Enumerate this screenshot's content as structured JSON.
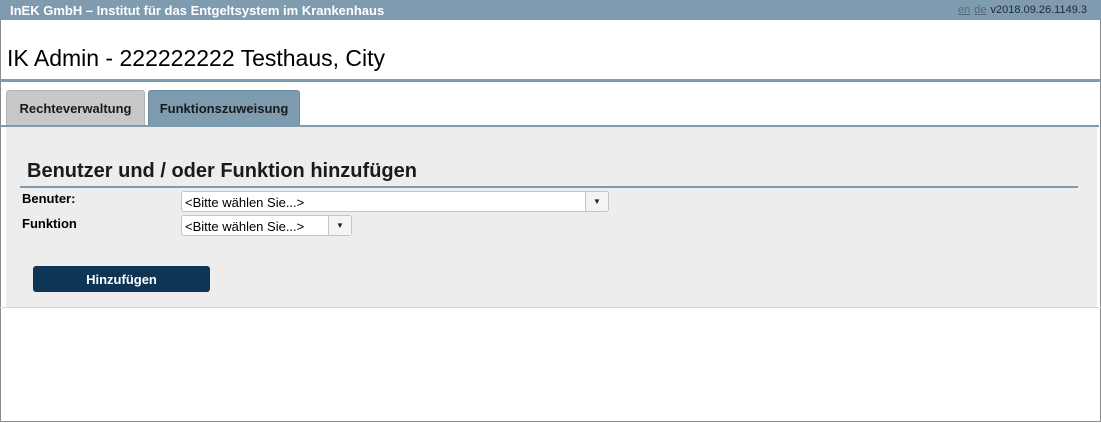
{
  "header": {
    "organization": "InEK GmbH – Institut für das Entgeltsystem im Krankenhaus",
    "lang_en": "en",
    "lang_de": "de",
    "version": "v2018.09.26.1149.3"
  },
  "page": {
    "title": "IK Admin - 222222222 Testhaus, City"
  },
  "tabs": [
    {
      "label": "Rechteverwaltung",
      "active": false
    },
    {
      "label": "Funktionszuweisung",
      "active": true
    }
  ],
  "form": {
    "heading": "Benutzer und / oder Funktion hinzufügen",
    "benutzer_label": "Benuter:",
    "benutzer_value": "<Bitte wählen Sie...>",
    "funktion_label": "Funktion",
    "funktion_value": "<Bitte wählen Sie...>",
    "submit_label": "Hinzufügen"
  },
  "icons": {
    "dropdown": "chevron-down-icon"
  },
  "colors": {
    "accent": "#7f9bb0",
    "button": "#0e3556",
    "panel": "#ededed"
  }
}
